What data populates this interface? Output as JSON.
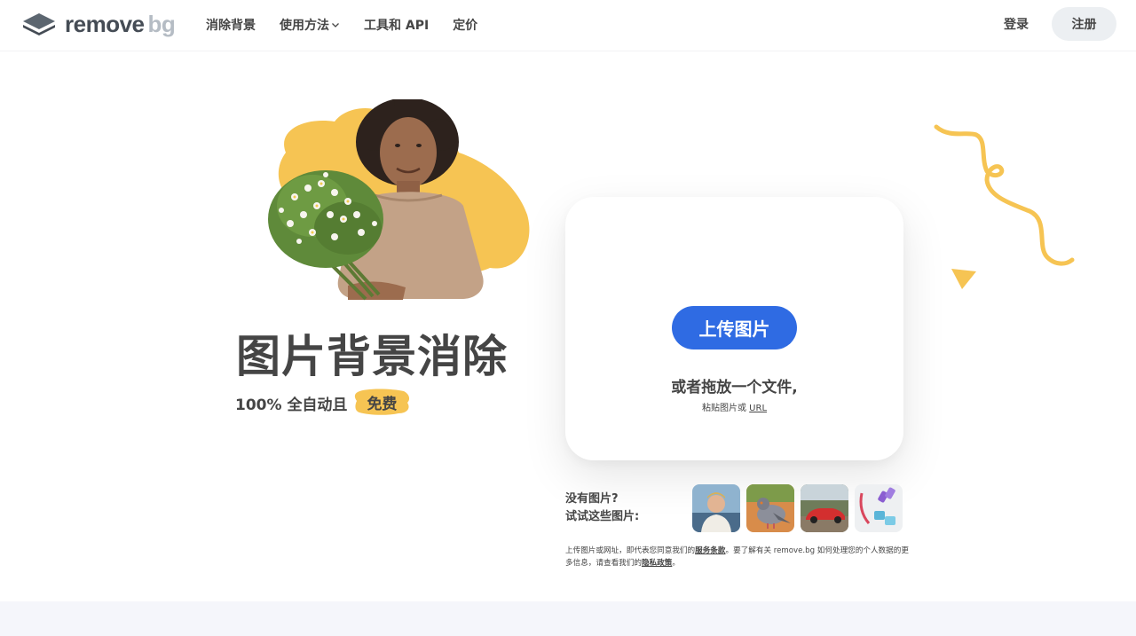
{
  "colors": {
    "accent": "#2f6be3",
    "yellow": "#f6c453",
    "text": "#454545",
    "signup_bg": "#eceff2",
    "band_bg": "#f5f6fb"
  },
  "header": {
    "logo_main": "remove",
    "logo_bg": "bg",
    "nav": [
      {
        "label": "消除背景"
      },
      {
        "label": "使用方法"
      },
      {
        "label": "工具和 API"
      },
      {
        "label": "定价"
      }
    ],
    "login_label": "登录",
    "signup_label": "注册"
  },
  "hero": {
    "title": "图片背景消除",
    "subtitle": "100% 全自动且",
    "free_badge": "免费"
  },
  "upload": {
    "button_label": "上传图片",
    "drop_text": "或者拖放一个文件,",
    "paste_prefix": "粘贴图片或",
    "paste_link": "URL"
  },
  "samples": {
    "line1": "没有图片?",
    "line2": "试试这些图片:",
    "items": [
      {
        "icon": "sample-man-photo"
      },
      {
        "icon": "sample-pigeon-photo"
      },
      {
        "icon": "sample-car-photo"
      },
      {
        "icon": "sample-dumbbells-photo"
      }
    ]
  },
  "legal": {
    "part1": "上传图片或网址，即代表您同意我们的",
    "terms_link": "服务条款",
    "part2": "。要了解有关 remove.bg 如何处理您的个人数据的更多信息，请查看我们的",
    "privacy_link": "隐私政策",
    "part3": "。"
  }
}
